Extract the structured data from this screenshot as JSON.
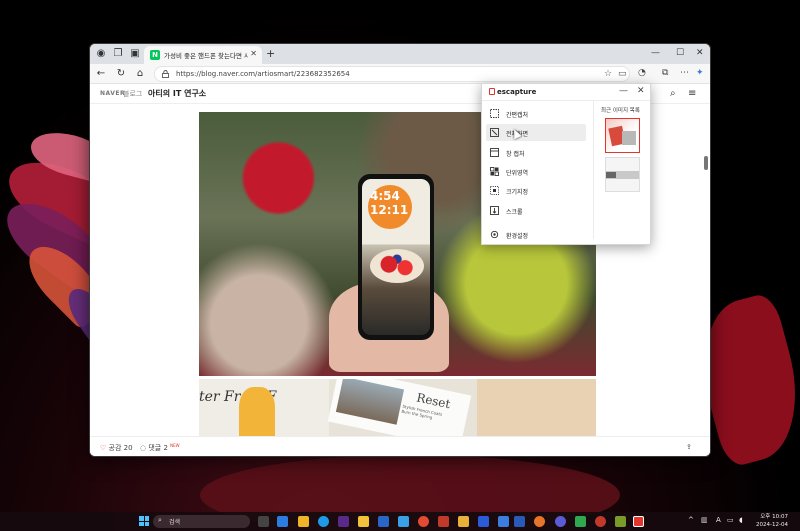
{
  "browser": {
    "tab_title": "가성비 좋은 핸드폰 찾는다면 사",
    "url": "https://blog.naver.com/artiosmart/223682352654"
  },
  "blog": {
    "naver_label": "NAVER",
    "blog_label": "블로그",
    "blog_name": "아티의 IT 연구소",
    "like_label": "공감 20",
    "comment_label": "댓글 2",
    "new_badge": "NEW"
  },
  "phone": {
    "time_top": "4:54",
    "time_bottom": "12:11"
  },
  "magazine": {
    "left_title": "ter From F",
    "right_title": "Reset",
    "right_subtitle": "Stylish French Coats\nBurn the Spring"
  },
  "escapture": {
    "logo": "escapture",
    "minimize": "—",
    "close": "✕",
    "menu": [
      {
        "label": "간편캡처",
        "icon": "simple-capture-icon"
      },
      {
        "label": "전체화면",
        "icon": "fullscreen-icon"
      },
      {
        "label": "창 캡처",
        "icon": "window-capture-icon"
      },
      {
        "label": "단위영역",
        "icon": "unit-area-icon"
      },
      {
        "label": "크기지정",
        "icon": "size-specify-icon"
      },
      {
        "label": "스크롤",
        "icon": "scroll-icon"
      }
    ],
    "settings": "환경설정",
    "recent_title": "최근 이미지 목록"
  },
  "taskbar": {
    "search_label": "검색",
    "lang": "A",
    "time": "오후 10:07",
    "date": "2024-12-04"
  },
  "colors": {
    "accent": "#e5352b",
    "naver_green": "#03c75a"
  }
}
